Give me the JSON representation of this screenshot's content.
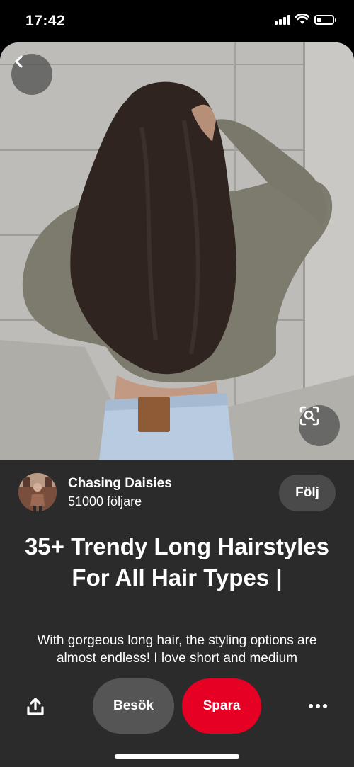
{
  "status_bar": {
    "time": "17:42",
    "icons": [
      "cellular-signal-icon",
      "wifi-icon",
      "battery-icon"
    ],
    "battery_level": 0.3
  },
  "pin": {
    "image_description_icon": "photo",
    "author": {
      "name": "Chasing Daisies",
      "followers": "51000 följare",
      "follow_label": "Följ"
    },
    "title": "35+ Trendy Long Hairstyles For All Hair Types |",
    "description": "With gorgeous long hair, the styling options are almost endless! I love short and medium"
  },
  "actions": {
    "visit_label": "Besök",
    "save_label": "Spara",
    "icons": [
      "share-icon",
      "more-options-icon"
    ]
  },
  "colors": {
    "save_button": "#e60023",
    "panel_background": "#2b2b2b",
    "visit_button": "#555555",
    "follow_button": "#4a4a4a"
  }
}
